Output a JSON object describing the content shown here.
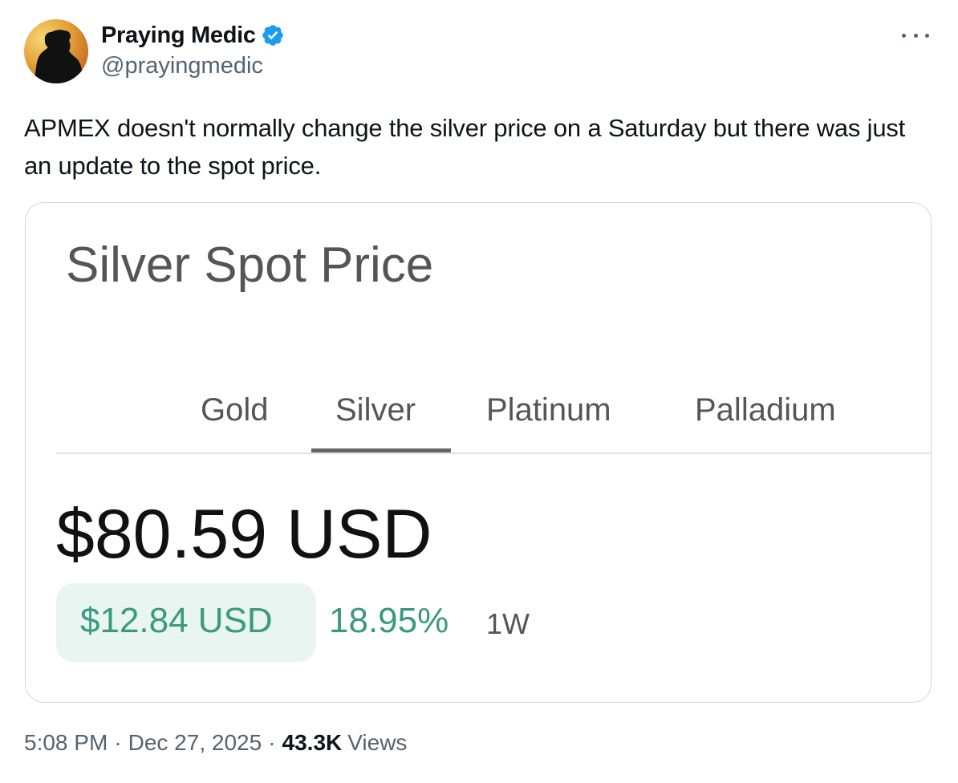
{
  "author": {
    "name": "Praying Medic",
    "handle": "@prayingmedic",
    "verified": true
  },
  "tweet": {
    "text": "APMEX doesn't normally change the silver price on a Saturday but there was just an update to the spot price."
  },
  "media": {
    "title": "Silver Spot Price",
    "tabs": [
      {
        "label": "Gold",
        "active": false
      },
      {
        "label": "Silver",
        "active": true
      },
      {
        "label": "Platinum",
        "active": false
      },
      {
        "label": "Palladium",
        "active": false
      }
    ],
    "price": "$80.59 USD",
    "change_amount": "$12.84 USD",
    "change_percent": "18.95%",
    "period": "1W"
  },
  "meta": {
    "time": "5:08 PM",
    "date": "Dec 27, 2025",
    "views_count": "43.3K",
    "views_label": "Views",
    "separator": "·"
  },
  "colors": {
    "verified_blue": "#1d9bf0",
    "positive_green": "#3a9a7c",
    "pill_background": "#e8f5f1",
    "secondary_text": "#536471"
  },
  "icons": {
    "more": "more-horizontal-icon",
    "verified": "verified-badge-icon"
  }
}
